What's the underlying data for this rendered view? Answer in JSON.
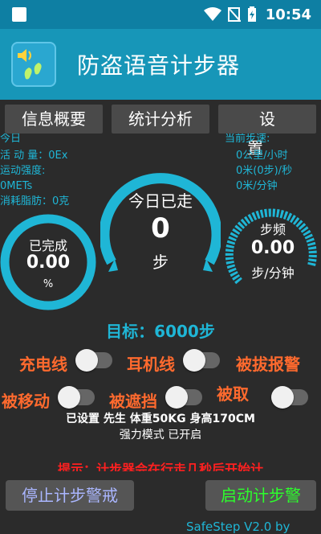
{
  "status": {
    "time": "10:54"
  },
  "app": {
    "title": "防盗语音计步器"
  },
  "tabs": [
    "信息概要",
    "统计分析",
    "设置"
  ],
  "stats_left": {
    "clipped_heading": "今日",
    "activity": "活 动 量：0Ex",
    "intensity_label": "运动强度:",
    "intensity_value": "0METs",
    "fat": "消耗脂肪：0克"
  },
  "stats_right": {
    "clipped_heading": "当前步速:",
    "speed_kmh": "0公里/小时",
    "speed_ms": "0米(0步)/秒",
    "speed_mmin": "0米/分钟"
  },
  "gauge_left": {
    "label": "已完成",
    "value": "0.00",
    "unit": "%"
  },
  "gauge_center": {
    "label": "今日已走",
    "value": "0",
    "unit": "步"
  },
  "gauge_right": {
    "label": "步频",
    "value": "0.00",
    "unit": "步/分钟"
  },
  "target": "目标：6000步",
  "toggles": [
    {
      "label": "充电线",
      "on": false
    },
    {
      "label": "耳机线",
      "on": false
    },
    {
      "label": "被拔报警"
    },
    {
      "label": "被移动",
      "on": false
    },
    {
      "label": "被遮挡",
      "on": false
    },
    {
      "label": "被取",
      "on": false
    }
  ],
  "info": {
    "line1": "已设置 先生 体重50KG 身高170CM",
    "line2": "强力模式 已开启"
  },
  "hint": "提示：计步器会在行走几秒后开始计",
  "buttons": {
    "stop": "停止计步警戒",
    "start": "启动计步警"
  },
  "footer": "SafeStep V2.0 by",
  "colors": {
    "accent": "#1fb6d6",
    "warning": "#ff6a2e",
    "appbar": "#1796b8"
  }
}
